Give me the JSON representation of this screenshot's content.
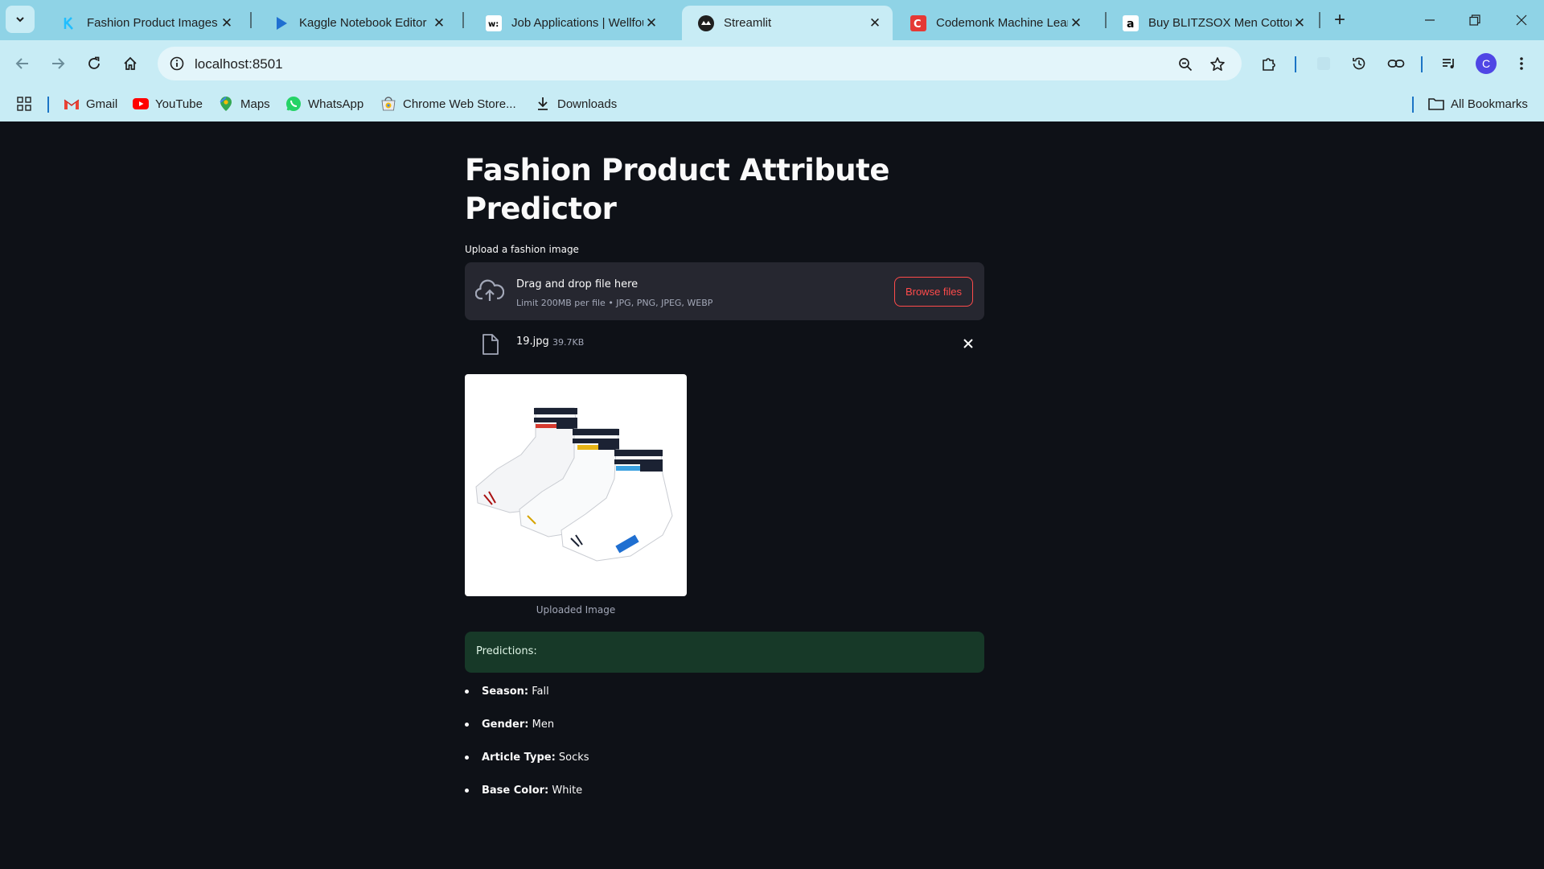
{
  "browser": {
    "tabs": [
      {
        "title": "Fashion Product Images Da",
        "icon": "kaggle-icon"
      },
      {
        "title": "Kaggle Notebook Editor",
        "icon": "play-icon"
      },
      {
        "title": "Job Applications | Wellfoun",
        "icon": "wellfound-icon"
      },
      {
        "title": "Streamlit",
        "icon": "streamlit-icon",
        "active": true
      },
      {
        "title": "Codemonk Machine Learni",
        "icon": "codemonk-icon"
      },
      {
        "title": "Buy BLITZSOX Men Cotton",
        "icon": "amazon-icon"
      }
    ],
    "url": "localhost:8501",
    "profile_initial": "C",
    "bookmarks": [
      {
        "label": "Gmail",
        "icon": "gmail-icon"
      },
      {
        "label": "YouTube",
        "icon": "youtube-icon"
      },
      {
        "label": "Maps",
        "icon": "maps-icon"
      },
      {
        "label": "WhatsApp",
        "icon": "whatsapp-icon"
      },
      {
        "label": "Chrome Web Store...",
        "icon": "chrome-web-store-icon"
      },
      {
        "label": "Downloads",
        "icon": "download-icon"
      }
    ],
    "all_bookmarks": "All Bookmarks",
    "colors": {
      "tabstrip": "#8fd3e6",
      "toolbar": "#c8ecf5",
      "omnibox": "#e3f5fa"
    }
  },
  "app": {
    "title": "Fashion Product Attribute Predictor",
    "uploader": {
      "label": "Upload a fashion image",
      "drag_text": "Drag and drop file here",
      "limit_text": "Limit 200MB per file • JPG, PNG, JPEG, WEBP",
      "browse_label": "Browse files"
    },
    "file": {
      "name": "19.jpg",
      "size": "39.7KB"
    },
    "image_caption": "Uploaded Image",
    "predictions_header": "Predictions:",
    "predictions": [
      {
        "key": "Season:",
        "value": "Fall"
      },
      {
        "key": "Gender:",
        "value": "Men"
      },
      {
        "key": "Article Type:",
        "value": "Socks"
      },
      {
        "key": "Base Color:",
        "value": "White"
      }
    ],
    "colors": {
      "background": "#0e1117",
      "primary": "#ff4b4b",
      "success_bg": "#173928"
    }
  }
}
